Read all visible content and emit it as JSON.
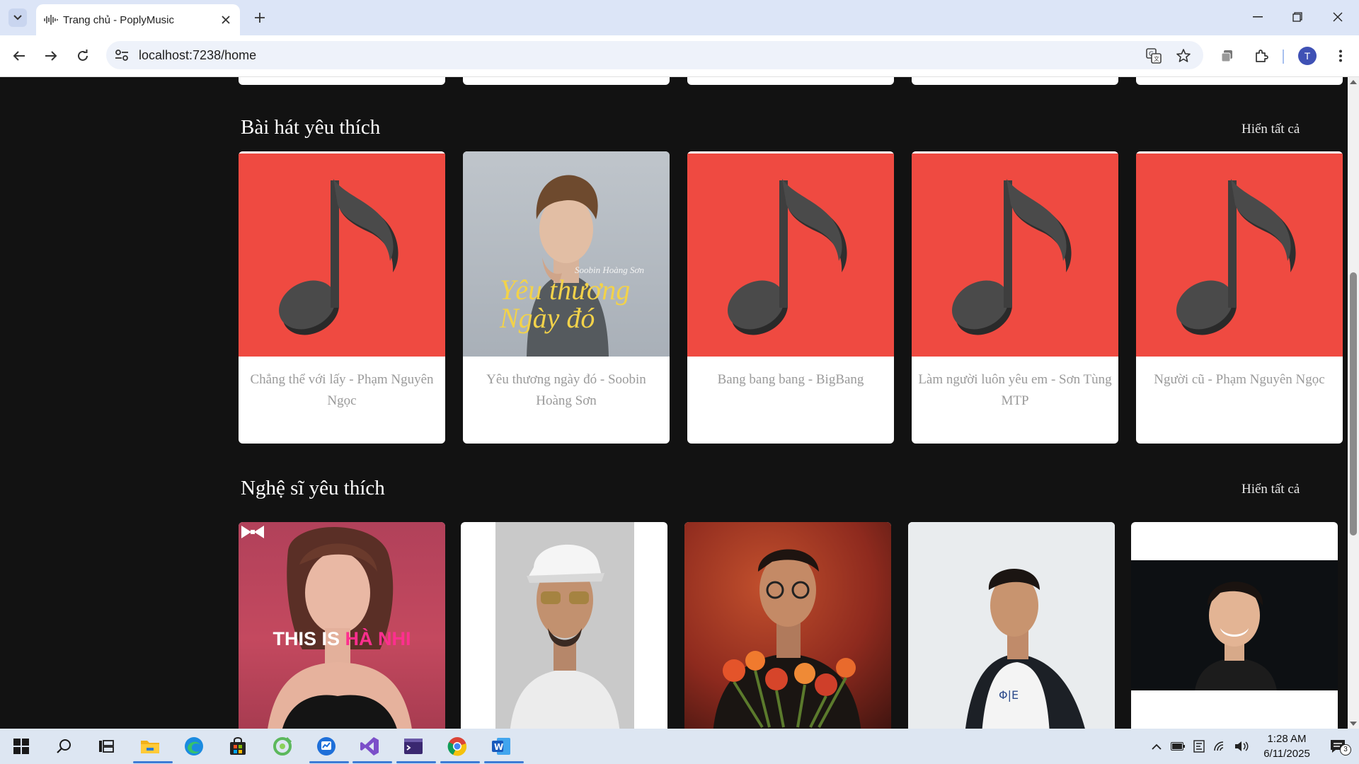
{
  "browser": {
    "tab_title": "Trang chủ - PoplyMusic",
    "url": "localhost:7238/home",
    "profile_initial": "T"
  },
  "page": {
    "favorite_songs": {
      "title": "Bài hát yêu thích",
      "see_all": "Hiển tất cả",
      "items": [
        {
          "name": "Chẳng thể với lấy - Phạm Nguyên Ngọc",
          "cover": "music-note-icon"
        },
        {
          "name": "Yêu thương ngày đó - Soobin Hoàng Sơn",
          "cover": "album-art",
          "cover_text_artist": "Soobin Hoàng Sơn",
          "cover_text_title": "Yêu thương Ngày đó"
        },
        {
          "name": "Bang bang bang - BigBang",
          "cover": "music-note-icon"
        },
        {
          "name": "Làm người luôn yêu em - Sơn Tùng MTP",
          "cover": "music-note-icon"
        },
        {
          "name": "Người cũ - Phạm Nguyên Ngọc",
          "cover": "music-note-icon"
        }
      ]
    },
    "favorite_artists": {
      "title": "Nghệ sĩ yêu thích",
      "see_all": "Hiển tất cả",
      "items": [
        {
          "photo": "artist-photo-1",
          "caption_white": "THIS IS ",
          "caption_pink": "HÀ NHI"
        },
        {
          "photo": "artist-photo-2"
        },
        {
          "photo": "artist-photo-3"
        },
        {
          "photo": "artist-photo-4"
        },
        {
          "photo": "artist-photo-5"
        }
      ]
    }
  },
  "taskbar": {
    "time": "1:28 AM",
    "date": "6/11/2025",
    "notification_count": "3"
  },
  "colors": {
    "page_bg": "#121212",
    "cover_red": "#ef4a41",
    "caption_pink": "#ff2f8f"
  }
}
